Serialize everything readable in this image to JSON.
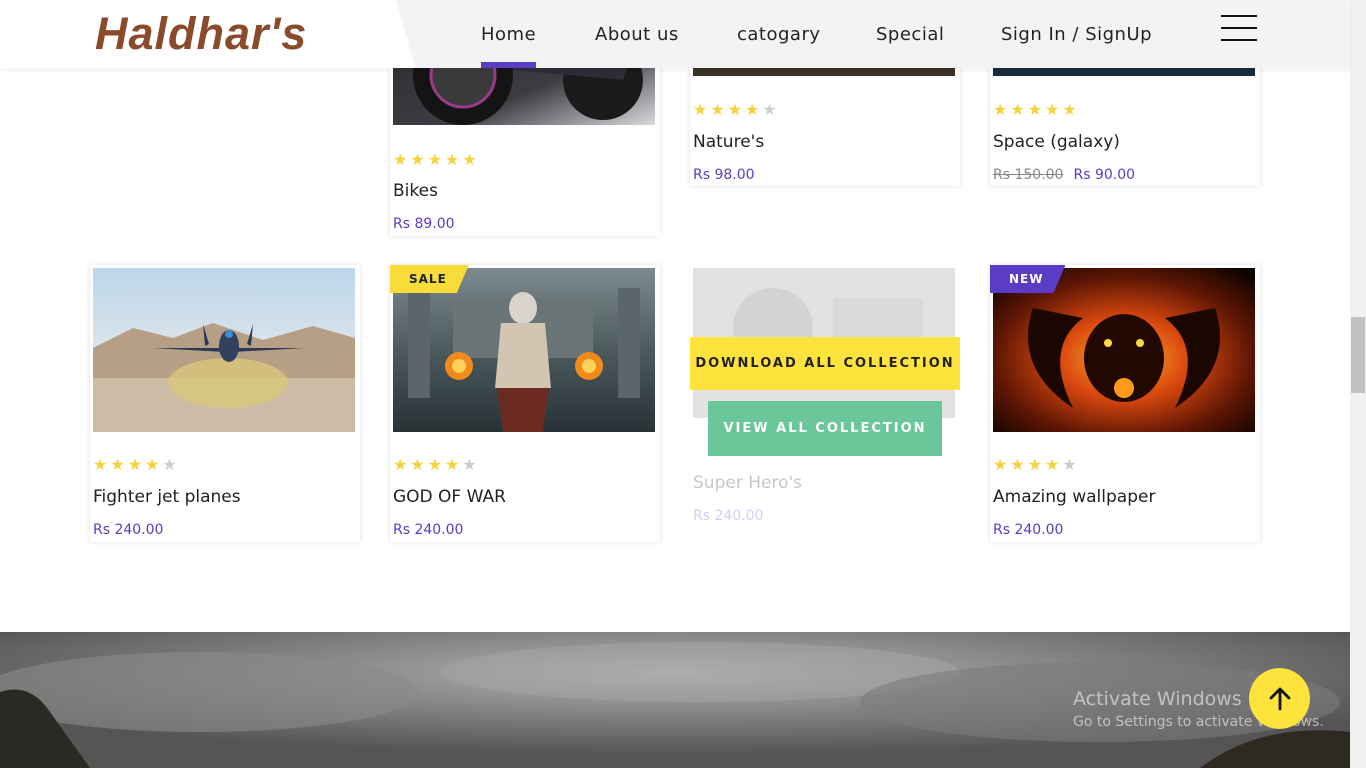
{
  "brand": {
    "logo": "Haldhar's"
  },
  "nav": {
    "items": [
      {
        "label": "Home",
        "active": true
      },
      {
        "label": "About us"
      },
      {
        "label": "catogary"
      },
      {
        "label": "Special"
      },
      {
        "label": "Sign In / SignUp"
      }
    ],
    "menu_icon": "hamburger-icon"
  },
  "products": [
    {
      "title": "Bikes",
      "price": "Rs 89.00",
      "rating": 5
    },
    {
      "title": "Nature's",
      "price": "Rs 98.00",
      "rating": 4
    },
    {
      "title": "Space (galaxy)",
      "old_price": "Rs 150.00",
      "price": "Rs 90.00",
      "rating": 5
    },
    {
      "title": "Fighter jet planes",
      "price": "Rs 240.00",
      "rating": 4
    },
    {
      "title": "GOD OF WAR",
      "price": "Rs 240.00",
      "rating": 4,
      "badge": "SALE"
    },
    {
      "title": "Super Hero's",
      "price": "Rs 240.00",
      "rating": 0
    },
    {
      "title": "Amazing wallpaper",
      "price": "Rs 240.00",
      "rating": 4,
      "badge": "NEW"
    }
  ],
  "overlay": {
    "download_label": "DOWNLOAD ALL COLLECTION",
    "view_label": "VIEW ALL COLLECTION"
  },
  "watermark": {
    "line1": "Activate Windows",
    "line2": "Go to Settings to activate Windows."
  },
  "colors": {
    "accent": "#5b3cc4",
    "star": "#f5d33a",
    "sale": "#f7dc3a",
    "download_button": "#fde33b",
    "view_button": "#6bc79a",
    "logo": "#8a4a2c"
  },
  "icons": {
    "scroll_top": "arrow-up-icon",
    "star": "star-icon"
  }
}
